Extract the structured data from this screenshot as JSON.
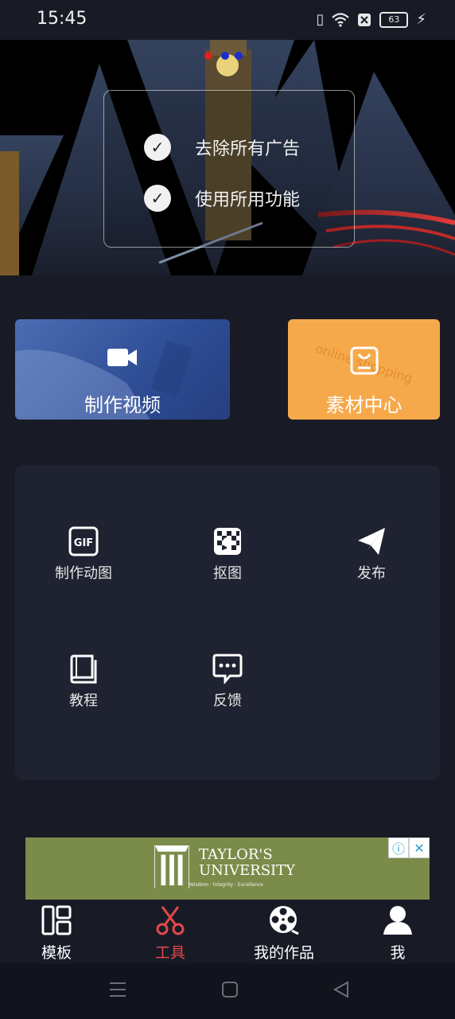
{
  "status_bar": {
    "time": "15:45",
    "battery": "63"
  },
  "banner": {
    "features": [
      "去除所有广告",
      "使用所用功能"
    ]
  },
  "cards": [
    {
      "label": "制作视频",
      "icon": "video-camera-icon"
    },
    {
      "label": "素材中心",
      "icon": "shopping-bag-icon",
      "bg_text": "online shopping"
    }
  ],
  "tools": [
    {
      "label": "制作动图",
      "icon": "gif-icon"
    },
    {
      "label": "抠图",
      "icon": "cutout-icon"
    },
    {
      "label": "发布",
      "icon": "paper-plane-icon"
    },
    {
      "label": "教程",
      "icon": "book-icon"
    },
    {
      "label": "反馈",
      "icon": "chat-bubble-icon"
    }
  ],
  "ad": {
    "brand": "TAYLOR'S",
    "brand_line2": "UNIVERSITY",
    "tagline": "Wisdom · Integrity · Excellence",
    "info_glyph": "ⓘ",
    "close_glyph": "✕"
  },
  "tabbar": [
    {
      "label": "模板",
      "icon": "template-grid-icon"
    },
    {
      "label": "工具",
      "icon": "scissors-icon",
      "active": true
    },
    {
      "label": "我的作品",
      "icon": "film-reel-icon"
    },
    {
      "label": "我",
      "icon": "person-icon"
    }
  ],
  "colors": {
    "background": "#181b26",
    "accent": "#e5474b",
    "material_card": "#f6a94a",
    "video_card": "#3a5aa6",
    "panel": "#1f2230"
  }
}
